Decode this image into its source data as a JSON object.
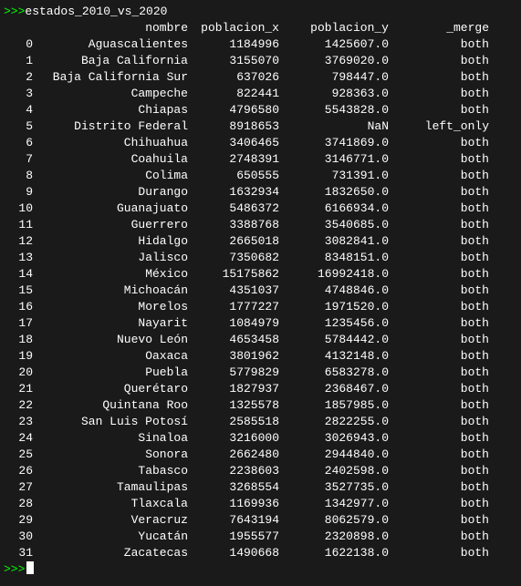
{
  "terminal": {
    "title": "estados_2010_vs_2020",
    "prompt": ">>>",
    "command": "estados_2010_vs_2020",
    "headers": {
      "index": "",
      "nombre": "nombre",
      "poblacion_x": "poblacion_x",
      "poblacion_y": "poblacion_y",
      "merge": "_merge"
    },
    "rows": [
      {
        "idx": "0",
        "nombre": "Aguascalientes",
        "pob_x": "1184996",
        "pob_y": "1425607.0",
        "merge": "both"
      },
      {
        "idx": "1",
        "nombre": "Baja California",
        "pob_x": "3155070",
        "pob_y": "3769020.0",
        "merge": "both"
      },
      {
        "idx": "2",
        "nombre": "Baja California Sur",
        "pob_x": "637026",
        "pob_y": "798447.0",
        "merge": "both"
      },
      {
        "idx": "3",
        "nombre": "Campeche",
        "pob_x": "822441",
        "pob_y": "928363.0",
        "merge": "both"
      },
      {
        "idx": "4",
        "nombre": "Chiapas",
        "pob_x": "4796580",
        "pob_y": "5543828.0",
        "merge": "both"
      },
      {
        "idx": "5",
        "nombre": "Distrito Federal",
        "pob_x": "8918653",
        "pob_y": "NaN",
        "merge": "left_only"
      },
      {
        "idx": "6",
        "nombre": "Chihuahua",
        "pob_x": "3406465",
        "pob_y": "3741869.0",
        "merge": "both"
      },
      {
        "idx": "7",
        "nombre": "Coahuila",
        "pob_x": "2748391",
        "pob_y": "3146771.0",
        "merge": "both"
      },
      {
        "idx": "8",
        "nombre": "Colima",
        "pob_x": "650555",
        "pob_y": "731391.0",
        "merge": "both"
      },
      {
        "idx": "9",
        "nombre": "Durango",
        "pob_x": "1632934",
        "pob_y": "1832650.0",
        "merge": "both"
      },
      {
        "idx": "10",
        "nombre": "Guanajuato",
        "pob_x": "5486372",
        "pob_y": "6166934.0",
        "merge": "both"
      },
      {
        "idx": "11",
        "nombre": "Guerrero",
        "pob_x": "3388768",
        "pob_y": "3540685.0",
        "merge": "both"
      },
      {
        "idx": "12",
        "nombre": "Hidalgo",
        "pob_x": "2665018",
        "pob_y": "3082841.0",
        "merge": "both"
      },
      {
        "idx": "13",
        "nombre": "Jalisco",
        "pob_x": "7350682",
        "pob_y": "8348151.0",
        "merge": "both"
      },
      {
        "idx": "14",
        "nombre": "México",
        "pob_x": "15175862",
        "pob_y": "16992418.0",
        "merge": "both"
      },
      {
        "idx": "15",
        "nombre": "Michoacán",
        "pob_x": "4351037",
        "pob_y": "4748846.0",
        "merge": "both"
      },
      {
        "idx": "16",
        "nombre": "Morelos",
        "pob_x": "1777227",
        "pob_y": "1971520.0",
        "merge": "both"
      },
      {
        "idx": "17",
        "nombre": "Nayarit",
        "pob_x": "1084979",
        "pob_y": "1235456.0",
        "merge": "both"
      },
      {
        "idx": "18",
        "nombre": "Nuevo León",
        "pob_x": "4653458",
        "pob_y": "5784442.0",
        "merge": "both"
      },
      {
        "idx": "19",
        "nombre": "Oaxaca",
        "pob_x": "3801962",
        "pob_y": "4132148.0",
        "merge": "both"
      },
      {
        "idx": "20",
        "nombre": "Puebla",
        "pob_x": "5779829",
        "pob_y": "6583278.0",
        "merge": "both"
      },
      {
        "idx": "21",
        "nombre": "Querétaro",
        "pob_x": "1827937",
        "pob_y": "2368467.0",
        "merge": "both"
      },
      {
        "idx": "22",
        "nombre": "Quintana Roo",
        "pob_x": "1325578",
        "pob_y": "1857985.0",
        "merge": "both"
      },
      {
        "idx": "23",
        "nombre": "San Luis Potosí",
        "pob_x": "2585518",
        "pob_y": "2822255.0",
        "merge": "both"
      },
      {
        "idx": "24",
        "nombre": "Sinaloa",
        "pob_x": "3216000",
        "pob_y": "3026943.0",
        "merge": "both"
      },
      {
        "idx": "25",
        "nombre": "Sonora",
        "pob_x": "2662480",
        "pob_y": "2944840.0",
        "merge": "both"
      },
      {
        "idx": "26",
        "nombre": "Tabasco",
        "pob_x": "2238603",
        "pob_y": "2402598.0",
        "merge": "both"
      },
      {
        "idx": "27",
        "nombre": "Tamaulipas",
        "pob_x": "3268554",
        "pob_y": "3527735.0",
        "merge": "both"
      },
      {
        "idx": "28",
        "nombre": "Tlaxcala",
        "pob_x": "1169936",
        "pob_y": "1342977.0",
        "merge": "both"
      },
      {
        "idx": "29",
        "nombre": "Veracruz",
        "pob_x": "7643194",
        "pob_y": "8062579.0",
        "merge": "both"
      },
      {
        "idx": "30",
        "nombre": "Yucatán",
        "pob_x": "1955577",
        "pob_y": "2320898.0",
        "merge": "both"
      },
      {
        "idx": "31",
        "nombre": "Zacatecas",
        "pob_x": "1490668",
        "pob_y": "1622138.0",
        "merge": "both"
      }
    ],
    "final_prompt": ">>>"
  }
}
